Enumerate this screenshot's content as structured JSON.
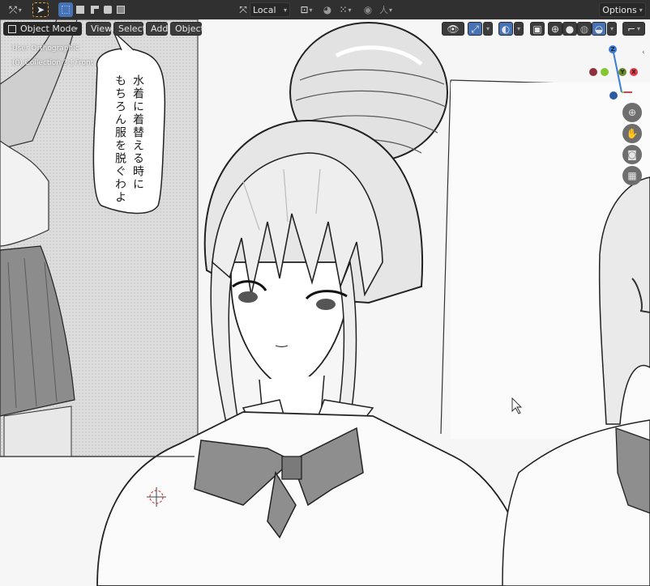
{
  "header": {
    "transform_orientation": "Local",
    "options_label": "Options",
    "snap_label": "人"
  },
  "viewport_header": {
    "mode_label": "Object Mode",
    "menus": [
      "View",
      "Select",
      "Add",
      "Object"
    ]
  },
  "overlay": {
    "view_name": "User Orthographic",
    "collection_info": "(0) Collection 3 | Front"
  },
  "gizmo": {
    "z_label": "Z",
    "x_label": "X",
    "y_label": "Y"
  },
  "manga": {
    "speech_bubble_line1": "水着に着替える時に",
    "speech_bubble_line2": "もちろん服を脱ぐわよ"
  },
  "colors": {
    "header_bg": "#303030",
    "active_blue": "#4772b3",
    "axis_x": "#e23c4b",
    "axis_y": "#84c72e",
    "axis_z": "#3a7bd8"
  }
}
